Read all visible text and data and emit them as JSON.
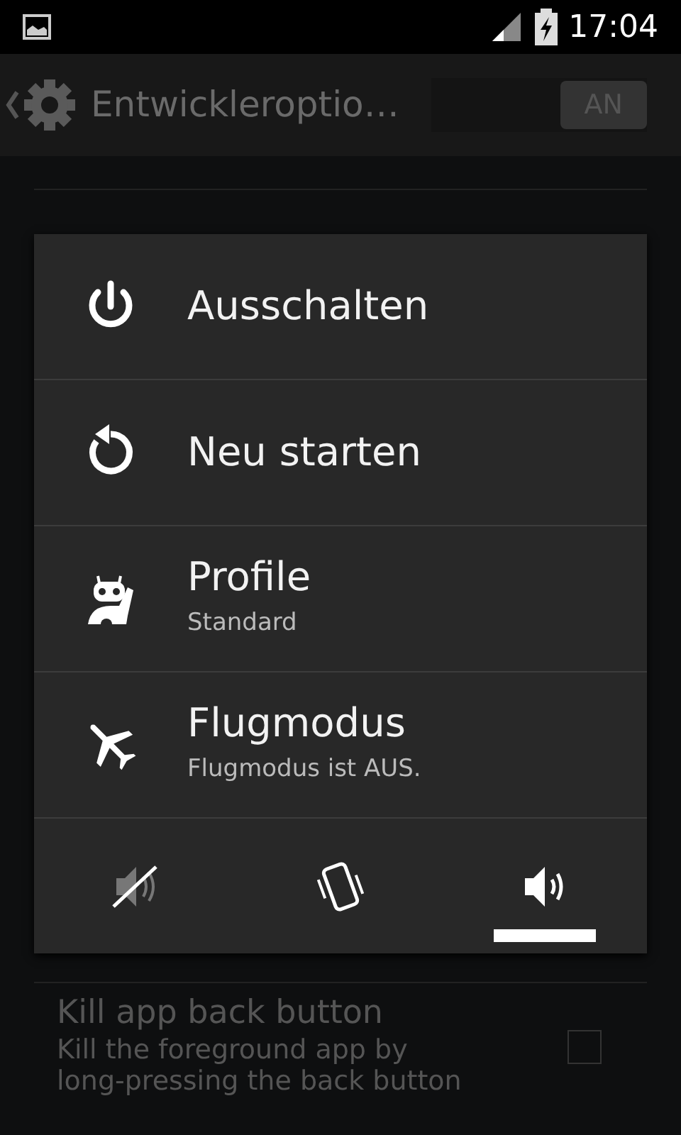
{
  "status_bar": {
    "time": "17:04"
  },
  "action_bar": {
    "title": "Entwickleroptio…",
    "switch": {
      "label": "AN",
      "on": true
    }
  },
  "settings": [
    {
      "kind": "checkbox",
      "title": "Kill app back button",
      "summary": "Kill the foreground app by long-pressing the back button",
      "checked": false
    }
  ],
  "power_menu": {
    "items": [
      {
        "kind": "power",
        "label": "Ausschalten"
      },
      {
        "kind": "reboot",
        "label": "Neu starten"
      },
      {
        "kind": "profile",
        "label": "Profile",
        "summary": "Standard"
      },
      {
        "kind": "airplane",
        "label": "Flugmodus",
        "summary": "Flugmodus ist AUS."
      }
    ],
    "sound_modes": [
      {
        "kind": "silent",
        "selected": false
      },
      {
        "kind": "vibrate",
        "selected": false
      },
      {
        "kind": "sound",
        "selected": true
      }
    ]
  }
}
